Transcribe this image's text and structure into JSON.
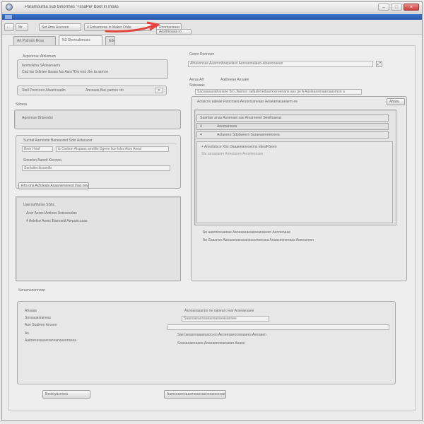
{
  "window": {
    "title": "Paramourtia sub   Binormes   '+ssaPer Boot in Inoas",
    "bluebar_text": ""
  },
  "toolbar": {
    "back_label": "‹",
    "save_label": "Mr",
    "btn_a": "Set  Amo  Ascreen",
    "btn_b": "4 Enhancese in Maker  Ohlie",
    "btn_c": "Ronntaosaas",
    "btn_d": "Aesitmoaas  ro"
  },
  "tabs": [
    {
      "label": "Art Potrrain  Ross"
    },
    {
      "label": "N3 Shorealemuss"
    },
    {
      "label": "Ede"
    }
  ],
  "left": {
    "group1": {
      "title": "Axpcornac Afolomum",
      "line1": "fanmeAiha SAdeamaers",
      "line2": "Cad fas Sdiniee ltiaaas fas  AaroTDis emt Jhe ta asmon"
    },
    "combo": {
      "label": "Stell Psorcoon Alwaricoadin",
      "value": "Anceaas Bac pamos cto"
    },
    "section_label": "Stinuss",
    "status_box": "Agesmue Brtseodor",
    "group2": {
      "title": "Suchal Aarmintie Baceaored Sotir Aslacacer",
      "field1": "Beer Hoaf",
      "field1_hint": "ts Carbon Alspaas amdilis Dgeen lice lolss Atos Areal",
      "label2": "Sisoelsn Banetl Kieonca",
      "field2": "Sactaiteclicaanilis"
    },
    "dropdown": "Rhs ons Aufoieats Asaanemenest ihas ony",
    "list_box": {
      "title": "Uaersufthoise SShc",
      "item1": "Aoer Aerecl Acttoes Astesesolas",
      "item2": "4 Aelefsrr Aeerc Bamoetil Aerpanccaae"
    }
  },
  "right": {
    "label1": "Gemo Rennoen",
    "path_field": "Ahiasonsas Aaarronhnepeiass Aenoaonalaeo-atoasooaeas",
    "label2": "Aeras Arf",
    "label2b": "Aaiibeeae Aesaee",
    "line3": "Sacsaasaoahaoane bro Jlaonso oafaslenedaamocreenans aas pe A  Aasieaesmaaroaasmon a",
    "label4": "Sisloaaas",
    "header_bar": "Aoascos aaleae Roocosea Aesonicaneaas Aeaeamasaeaem ee",
    "header_btn": "Ahasu",
    "list_rows": [
      {
        "col1": "Saarfasr anas Asoenaei sae Amarneeel Seeiltoaeas",
        "col2": ""
      },
      {
        "col1": "4",
        "col2": "Anemaroees"
      },
      {
        "col1": "4",
        "col2": "Aolaseso Sdpbueem Saraeaoreeeioeea"
      }
    ],
    "detail_title": "+ Ansotstsce  Xbs Oaaaeeaneseons  ebeaFSeeo",
    "detail_line": "Ste  aesaoaom Aoneiaoes  Aooeieenaes",
    "bottom_rows": [
      {
        "text": "Ae  aarenioeaeeae Asoeaseaeaaoeanaseen  Aennenaae"
      },
      {
        "text": "Ae  Saasnoe  Aaoaaeoaeasaosaaonieeaea Aoaaseoneeaas  Aseoaeonn"
      }
    ]
  },
  "lower": {
    "label": "Serasnanonnoen",
    "col1": [
      "Ahaaas",
      "Sossauaoianeas",
      "Aoe Sualeeo Aroseo",
      "As",
      "Aatioessssaseoaneanaseenssea"
    ],
    "col2": [
      "Asnoaoasanoo  ne oaoeal o ear Aoseaesaee",
      "Saaooaeaoosaeaosaoaeasaonee",
      "",
      "Sae  laeaseeaaaeasoo eo Aeoeesaeooseaaees Aeeaaen",
      "Soaoaeaeeaaea Aoaeaeeoeaeaean Aeaoe"
    ]
  },
  "footer": {
    "button1": "Beotoyaseoea",
    "button2": "Aamsoaeeoaasmeaesasoeoaoeesaes"
  },
  "colors": {
    "accent_blue": "#2f62b8",
    "arrow_red": "#e2463f"
  }
}
